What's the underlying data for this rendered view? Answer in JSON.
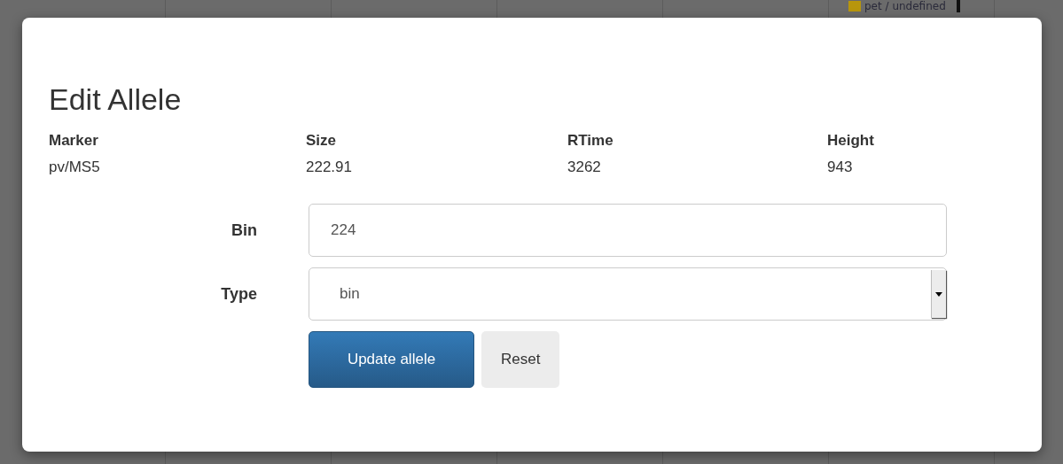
{
  "background": {
    "legend": {
      "label": "pet / undefined",
      "color": "#b8960c"
    }
  },
  "dialog": {
    "title": "Edit Allele",
    "details": [
      {
        "label": "Marker",
        "value": "pv/MS5"
      },
      {
        "label": "Size",
        "value": "222.91"
      },
      {
        "label": "RTime",
        "value": "3262"
      },
      {
        "label": "Height",
        "value": "943"
      }
    ],
    "fields": [
      {
        "kind": "text",
        "label": "Bin",
        "value": "224"
      },
      {
        "kind": "select",
        "label": "Type",
        "value": "bin"
      }
    ],
    "buttons": [
      {
        "label": "Update allele",
        "kind": "primary"
      },
      {
        "label": "Reset",
        "kind": "default"
      }
    ]
  }
}
